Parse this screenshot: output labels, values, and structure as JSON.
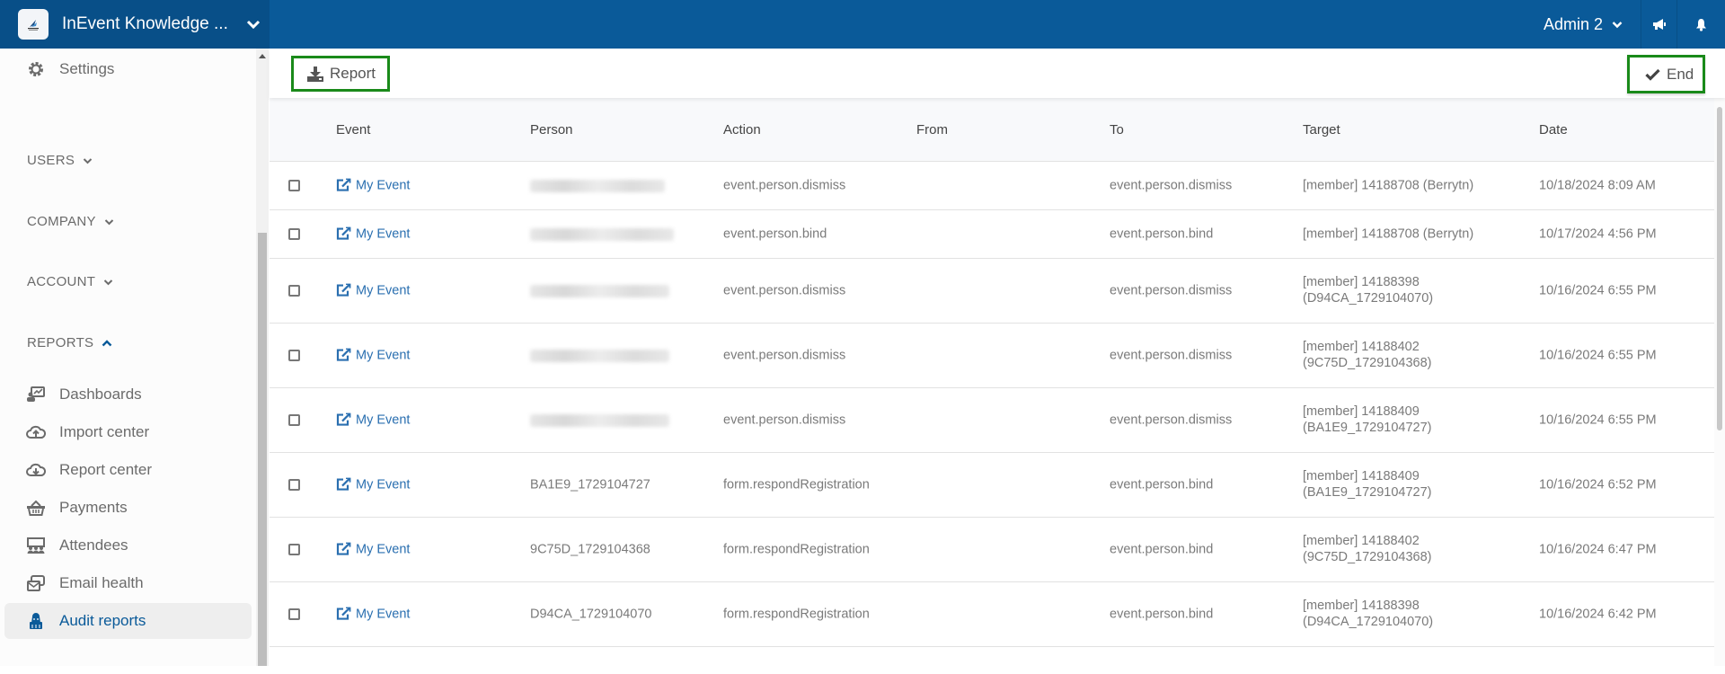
{
  "header": {
    "app_title": "InEvent Knowledge ...",
    "user_name": "Admin 2",
    "icons": [
      "megaphone-icon",
      "bell-icon"
    ]
  },
  "sidebar": {
    "settings_label": "Settings",
    "sections": [
      {
        "label": "USERS",
        "expanded": false
      },
      {
        "label": "COMPANY",
        "expanded": false
      },
      {
        "label": "ACCOUNT",
        "expanded": false
      },
      {
        "label": "REPORTS",
        "expanded": true
      }
    ],
    "report_items": [
      {
        "label": "Dashboards",
        "icon": "dashboard-icon"
      },
      {
        "label": "Import center",
        "icon": "cloud-upload-icon"
      },
      {
        "label": "Report center",
        "icon": "cloud-download-icon"
      },
      {
        "label": "Payments",
        "icon": "basket-icon"
      },
      {
        "label": "Attendees",
        "icon": "attendees-icon"
      },
      {
        "label": "Email health",
        "icon": "email-health-icon"
      },
      {
        "label": "Audit reports",
        "icon": "audit-icon",
        "active": true
      }
    ],
    "accent_color": "#0a5a99"
  },
  "toolbar": {
    "report_label": "Report",
    "end_label": "End"
  },
  "table": {
    "columns": [
      "Event",
      "Person",
      "Action",
      "From",
      "To",
      "Target",
      "Date"
    ],
    "rows": [
      {
        "event": "My Event",
        "person": "",
        "person_redacted": true,
        "action": "event.person.dismiss",
        "from": "",
        "to": "event.person.dismiss",
        "target_line1": "[member] 14188708 (Berrytn)",
        "target_line2": "",
        "date": "10/18/2024 8:09 AM"
      },
      {
        "event": "My Event",
        "person": "",
        "person_redacted": true,
        "action": "event.person.bind",
        "from": "",
        "to": "event.person.bind",
        "target_line1": "[member] 14188708 (Berrytn)",
        "target_line2": "",
        "date": "10/17/2024 4:56 PM"
      },
      {
        "event": "My Event",
        "person": "",
        "person_redacted": true,
        "action": "event.person.dismiss",
        "from": "",
        "to": "event.person.dismiss",
        "target_line1": "[member] 14188398",
        "target_line2": "(D94CA_1729104070)",
        "date": "10/16/2024 6:55 PM"
      },
      {
        "event": "My Event",
        "person": "",
        "person_redacted": true,
        "action": "event.person.dismiss",
        "from": "",
        "to": "event.person.dismiss",
        "target_line1": "[member] 14188402",
        "target_line2": "(9C75D_1729104368)",
        "date": "10/16/2024 6:55 PM"
      },
      {
        "event": "My Event",
        "person": "",
        "person_redacted": true,
        "action": "event.person.dismiss",
        "from": "",
        "to": "event.person.dismiss",
        "target_line1": "[member] 14188409",
        "target_line2": "(BA1E9_1729104727)",
        "date": "10/16/2024 6:55 PM"
      },
      {
        "event": "My Event",
        "person": "BA1E9_1729104727",
        "person_redacted": false,
        "action": "form.respondRegistration",
        "from": "",
        "to": "event.person.bind",
        "target_line1": "[member] 14188409",
        "target_line2": "(BA1E9_1729104727)",
        "date": "10/16/2024 6:52 PM"
      },
      {
        "event": "My Event",
        "person": "9C75D_1729104368",
        "person_redacted": false,
        "action": "form.respondRegistration",
        "from": "",
        "to": "event.person.bind",
        "target_line1": "[member] 14188402",
        "target_line2": "(9C75D_1729104368)",
        "date": "10/16/2024 6:47 PM"
      },
      {
        "event": "My Event",
        "person": "D94CA_1729104070",
        "person_redacted": false,
        "action": "form.respondRegistration",
        "from": "",
        "to": "event.person.bind",
        "target_line1": "[member] 14188398",
        "target_line2": "(D94CA_1729104070)",
        "date": "10/16/2024 6:42 PM"
      }
    ]
  }
}
